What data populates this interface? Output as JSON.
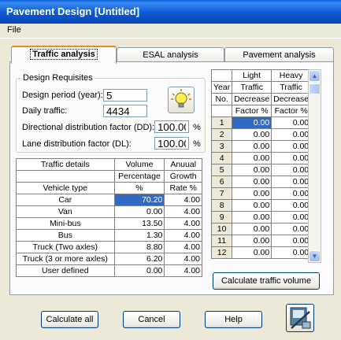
{
  "window": {
    "title": "Pavement Design [Untitled]"
  },
  "menu": {
    "file": "File"
  },
  "tabs": [
    {
      "label": "Traffic analysis"
    },
    {
      "label": "ESAL analysis"
    },
    {
      "label": "Pavement analysis"
    }
  ],
  "requisites": {
    "title": "Design Requisites",
    "design_period_label": "Design period (year):",
    "design_period": "5",
    "daily_traffic_label": "Daily traffic:",
    "daily_traffic": "4434",
    "dd_label": "Directional distribution factor (DD):",
    "dd_value": "100.00",
    "dd_unit": "%",
    "dl_label": "Lane distribution factor (DL):",
    "dl_value": "100.00",
    "dl_unit": "%"
  },
  "traffic_table": {
    "h1": [
      "Traffic details",
      "Volume",
      "Anuual"
    ],
    "h2": [
      "",
      "Percentage",
      "Growth"
    ],
    "h3": [
      "Vehicle type",
      "%",
      "Rate %"
    ],
    "rows": [
      [
        "Car",
        "70.20",
        "4.00"
      ],
      [
        "Van",
        "0.00",
        "4.00"
      ],
      [
        "Mini-bus",
        "13.50",
        "4.00"
      ],
      [
        "Bus",
        "1.30",
        "4.00"
      ],
      [
        "Truck (Two axles)",
        "8.80",
        "4.00"
      ],
      [
        "Truck (3 or more axles)",
        "6.20",
        "4.00"
      ],
      [
        "User defined",
        "0.00",
        "4.00"
      ]
    ]
  },
  "growth_table": {
    "h1": [
      "",
      "Light",
      "Heavy"
    ],
    "h2": [
      "Year",
      "Traffic",
      "Traffic"
    ],
    "h3": [
      "No.",
      "Decrease",
      "Decrease"
    ],
    "h4": [
      "",
      "Factor %",
      "Factor %"
    ],
    "rows": [
      [
        "1",
        "0.00",
        "0.00"
      ],
      [
        "2",
        "0.00",
        "0.00"
      ],
      [
        "3",
        "0.00",
        "0.00"
      ],
      [
        "4",
        "0.00",
        "0.00"
      ],
      [
        "5",
        "0.00",
        "0.00"
      ],
      [
        "6",
        "0.00",
        "0.00"
      ],
      [
        "7",
        "0.00",
        "0.00"
      ],
      [
        "8",
        "0.00",
        "0.00"
      ],
      [
        "9",
        "0.00",
        "0.00"
      ],
      [
        "10",
        "0.00",
        "0.00"
      ],
      [
        "11",
        "0.00",
        "0.00"
      ],
      [
        "12",
        "0.00",
        "0.00"
      ]
    ]
  },
  "buttons": {
    "calc_traffic": "Calculate traffic volume",
    "calc_all": "Calculate all",
    "cancel": "Cancel",
    "help": "Help"
  }
}
